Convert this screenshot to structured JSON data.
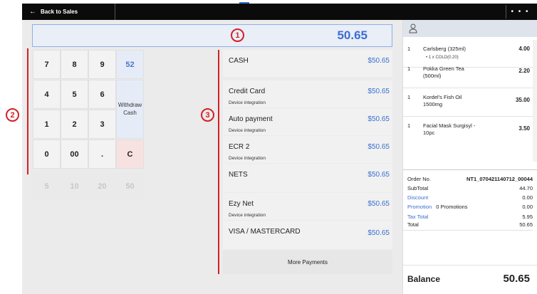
{
  "topbar": {
    "back_label": "Back to Sales",
    "back_arrow": "←",
    "more_glyph": "• • •"
  },
  "amount": "50.65",
  "annotations": [
    "1",
    "2",
    "3"
  ],
  "keypad": {
    "rows": [
      [
        "7",
        "8",
        "9",
        "52"
      ],
      [
        "4",
        "5",
        "6"
      ],
      [
        "1",
        "2",
        "3"
      ],
      [
        "0",
        "00",
        ".",
        "C"
      ]
    ],
    "withdraw_cash": "Withdraw\nCash",
    "quick": [
      "5",
      "10",
      "20",
      "50"
    ]
  },
  "payments": [
    {
      "name": "CASH",
      "amount": "$50.65",
      "sub": ""
    },
    {
      "name": "Credit Card",
      "amount": "$50.65",
      "sub": "Device integration"
    },
    {
      "name": "Auto payment",
      "amount": "$50.65",
      "sub": "Device integration"
    },
    {
      "name": "ECR 2",
      "amount": "$50.65",
      "sub": "Device integration"
    },
    {
      "name": "NETS",
      "amount": "$50.65",
      "sub": ""
    },
    {
      "name": "Ezy Net",
      "amount": "$50.65",
      "sub": "Device integration"
    },
    {
      "name": "VISA / MASTERCARD",
      "amount": "$50.65",
      "sub": ""
    }
  ],
  "more_payments": "More Payments",
  "cart": {
    "items": [
      {
        "qty": "1",
        "name": "Carlsberg (325ml)",
        "price": "4.00",
        "modifier": "• 1 x COLD(0.20)"
      },
      {
        "qty": "1",
        "name": "Pokka Green Tea (500ml)",
        "price": "2.20",
        "modifier": ""
      },
      {
        "qty": "1",
        "name": "Kordel's Fish Oil 1500mg",
        "price": "35.00",
        "modifier": ""
      },
      {
        "qty": "1",
        "name": "Facial Mask Surgisyl - 10pc",
        "price": "3.50",
        "modifier": ""
      }
    ],
    "order_no_label": "Order No.",
    "order_no": "NT1_070421140712_00044",
    "subtotal_label": "SubTotal",
    "subtotal": "44.70",
    "discount_label": "Discount",
    "discount": "0.00",
    "promotion_label": "Promotion",
    "promotion_text": "0 Promotions",
    "promotion": "0.00",
    "tax_label": "Tax Total",
    "tax": "5.95",
    "total_label": "Total",
    "total": "50.65",
    "balance_label": "Balance",
    "balance": "50.65"
  },
  "colors": {
    "accent": "#3b6fd1",
    "annotation": "#d51f26",
    "topbar": "#0b0b0b"
  }
}
